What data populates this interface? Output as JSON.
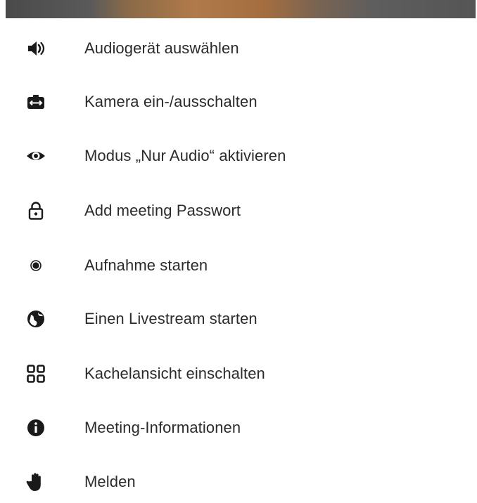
{
  "menu": {
    "items": [
      {
        "label": "Audiogerät auswählen",
        "icon": "speaker-icon"
      },
      {
        "label": "Kamera ein-/ausschalten",
        "icon": "camera-switch-icon"
      },
      {
        "label": "Modus „Nur Audio“ aktivieren",
        "icon": "eye-icon"
      },
      {
        "label": "Add meeting Passwort",
        "icon": "lock-icon"
      },
      {
        "label": "Aufnahme starten",
        "icon": "record-icon"
      },
      {
        "label": "Einen Livestream starten",
        "icon": "globe-icon"
      },
      {
        "label": "Kachelansicht einschalten",
        "icon": "tile-view-icon"
      },
      {
        "label": "Meeting-Informationen",
        "icon": "info-icon"
      },
      {
        "label": "Melden",
        "icon": "raise-hand-icon"
      }
    ]
  },
  "colors": {
    "text": "#2b2b2b",
    "icon": "#1a1a1a",
    "background": "#ffffff"
  }
}
